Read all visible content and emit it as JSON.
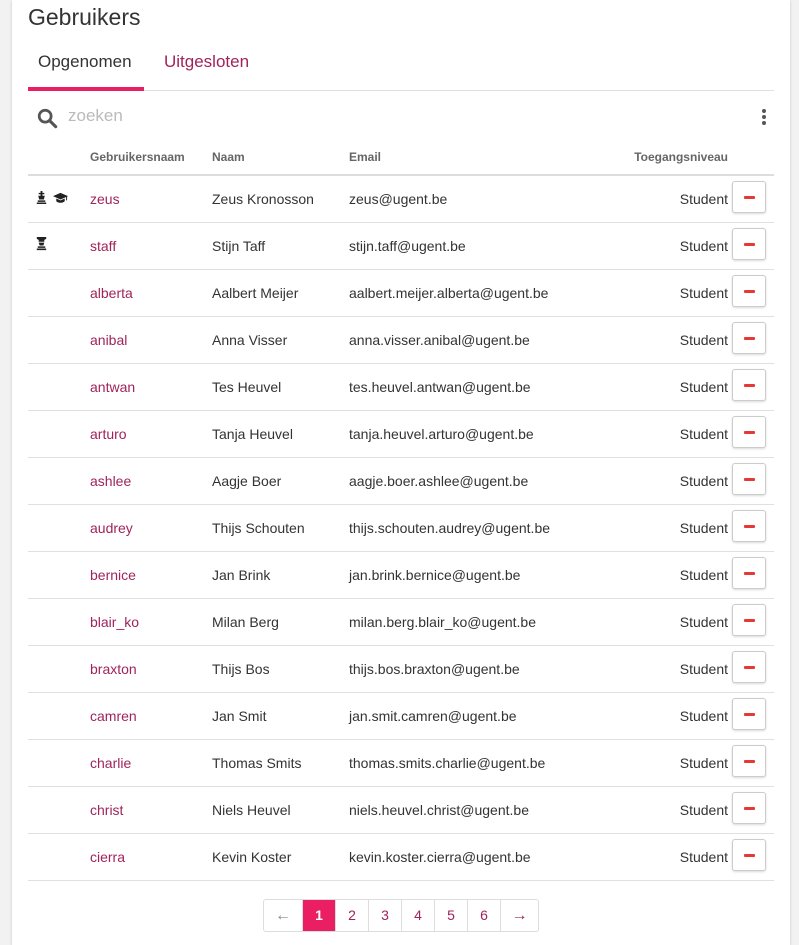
{
  "page": {
    "title": "Gebruikers"
  },
  "tabs": [
    {
      "label": "Opgenomen",
      "active": true
    },
    {
      "label": "Uitgesloten",
      "active": false
    }
  ],
  "search": {
    "placeholder": "zoeken",
    "value": ""
  },
  "table": {
    "headers": [
      "",
      "Gebruikersnaam",
      "Naam",
      "Email",
      "Toegangsniveau",
      ""
    ],
    "rows": [
      {
        "icons": [
          "chess-king-icon",
          "graduation-cap-icon"
        ],
        "username": "zeus",
        "name": "Zeus Kronosson",
        "email": "zeus@ugent.be",
        "level": "Student"
      },
      {
        "icons": [
          "chess-piece-icon"
        ],
        "username": "staff",
        "name": "Stijn Taff",
        "email": "stijn.taff@ugent.be",
        "level": "Student"
      },
      {
        "icons": [],
        "username": "alberta",
        "name": "Aalbert Meijer",
        "email": "aalbert.meijer.alberta@ugent.be",
        "level": "Student"
      },
      {
        "icons": [],
        "username": "anibal",
        "name": "Anna Visser",
        "email": "anna.visser.anibal@ugent.be",
        "level": "Student"
      },
      {
        "icons": [],
        "username": "antwan",
        "name": "Tes Heuvel",
        "email": "tes.heuvel.antwan@ugent.be",
        "level": "Student"
      },
      {
        "icons": [],
        "username": "arturo",
        "name": "Tanja Heuvel",
        "email": "tanja.heuvel.arturo@ugent.be",
        "level": "Student"
      },
      {
        "icons": [],
        "username": "ashlee",
        "name": "Aagje Boer",
        "email": "aagje.boer.ashlee@ugent.be",
        "level": "Student"
      },
      {
        "icons": [],
        "username": "audrey",
        "name": "Thijs Schouten",
        "email": "thijs.schouten.audrey@ugent.be",
        "level": "Student"
      },
      {
        "icons": [],
        "username": "bernice",
        "name": "Jan Brink",
        "email": "jan.brink.bernice@ugent.be",
        "level": "Student"
      },
      {
        "icons": [],
        "username": "blair_ko",
        "name": "Milan Berg",
        "email": "milan.berg.blair_ko@ugent.be",
        "level": "Student"
      },
      {
        "icons": [],
        "username": "braxton",
        "name": "Thijs Bos",
        "email": "thijs.bos.braxton@ugent.be",
        "level": "Student"
      },
      {
        "icons": [],
        "username": "camren",
        "name": "Jan Smit",
        "email": "jan.smit.camren@ugent.be",
        "level": "Student"
      },
      {
        "icons": [],
        "username": "charlie",
        "name": "Thomas Smits",
        "email": "thomas.smits.charlie@ugent.be",
        "level": "Student"
      },
      {
        "icons": [],
        "username": "christ",
        "name": "Niels Heuvel",
        "email": "niels.heuvel.christ@ugent.be",
        "level": "Student"
      },
      {
        "icons": [],
        "username": "cierra",
        "name": "Kevin Koster",
        "email": "kevin.koster.cierra@ugent.be",
        "level": "Student"
      }
    ]
  },
  "pagination": {
    "prev": "←",
    "next": "→",
    "pages": [
      "1",
      "2",
      "3",
      "4",
      "5",
      "6"
    ],
    "current": "1"
  },
  "colors": {
    "accent": "#e91e63",
    "link": "#a0245b",
    "remove": "#e53935"
  }
}
